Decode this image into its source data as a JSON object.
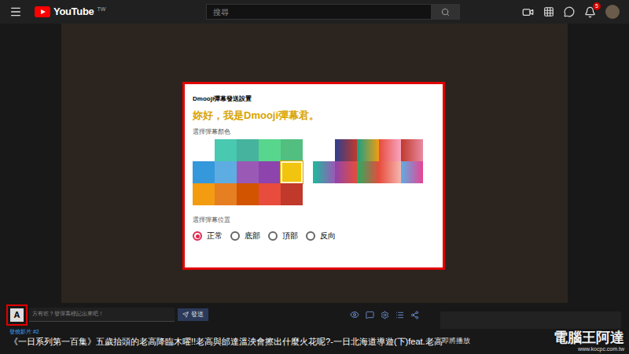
{
  "header": {
    "logo": "YouTube",
    "region": "TW",
    "search_placeholder": "搜尋",
    "notifications": "5"
  },
  "dialog": {
    "title": "Dmooji彈幕發送設置",
    "greeting": "妳好，我是Dmooji彈幕君。",
    "color_label": "選擇彈幕顏色",
    "solid_colors": [
      {
        "color": "#48c9b0",
        "selected": false
      },
      {
        "color": "#45b39d",
        "selected": false
      },
      {
        "color": "#58d68d",
        "selected": false
      },
      {
        "color": "#52be80",
        "selected": false
      },
      {
        "color": "#3498db",
        "selected": false
      },
      {
        "color": "#5dade2",
        "selected": false
      },
      {
        "color": "#9b59b6",
        "selected": false
      },
      {
        "color": "#8e44ad",
        "selected": false
      },
      {
        "color": "#f1c40f",
        "selected": true
      },
      {
        "color": "#f39c12",
        "selected": false
      },
      {
        "color": "#e67e22",
        "selected": false
      },
      {
        "color": "#d35400",
        "selected": false
      },
      {
        "color": "#e74c3c",
        "selected": false
      },
      {
        "color": "#c0392b",
        "selected": false
      }
    ],
    "gradients": [
      {
        "colors": [
          "#ffffff",
          "#ffffff"
        ],
        "selected": false
      },
      {
        "colors": [
          "#2c3e90",
          "#c0392b"
        ],
        "selected": false
      },
      {
        "colors": [
          "#16a085",
          "#f39c12"
        ],
        "selected": false
      },
      {
        "colors": [
          "#e74c3c",
          "#f8a5c2"
        ],
        "selected": false
      },
      {
        "colors": [
          "#c0392b",
          "#e98aa0"
        ],
        "selected": false
      },
      {
        "colors": [
          "#1abc9c",
          "#9b59b6"
        ],
        "selected": false
      },
      {
        "colors": [
          "#8e44ad",
          "#e74c3c"
        ],
        "selected": false
      },
      {
        "colors": [
          "#27ae60",
          "#e74c3c"
        ],
        "selected": false
      },
      {
        "colors": [
          "#e74c3c",
          "#f5b7b1"
        ],
        "selected": false
      },
      {
        "colors": [
          "#5dade2",
          "#e84393"
        ],
        "selected": false
      }
    ],
    "position_label": "選擇彈幕位置",
    "positions": [
      {
        "label": "正常",
        "selected": true
      },
      {
        "label": "底部",
        "selected": false
      },
      {
        "label": "頂部",
        "selected": false
      },
      {
        "label": "反向",
        "selected": false
      }
    ]
  },
  "danmaku_bar": {
    "toggle": "A",
    "placeholder": "方有乾？發彈幕標記出來吧！",
    "send": "發送"
  },
  "video_info": {
    "tag": "發燒影片 #2",
    "title": "《一日系列第一百集》五歲抬頭的老高降臨木曜!!老高與邰達溫泱會擦出什麼火花呢?-一日北海道導遊(下)feat.老高"
  },
  "sidebar": {
    "heading": "即將播放"
  },
  "watermark": {
    "name": "電腦王阿達",
    "url": "www.kocpc.com.tw"
  }
}
